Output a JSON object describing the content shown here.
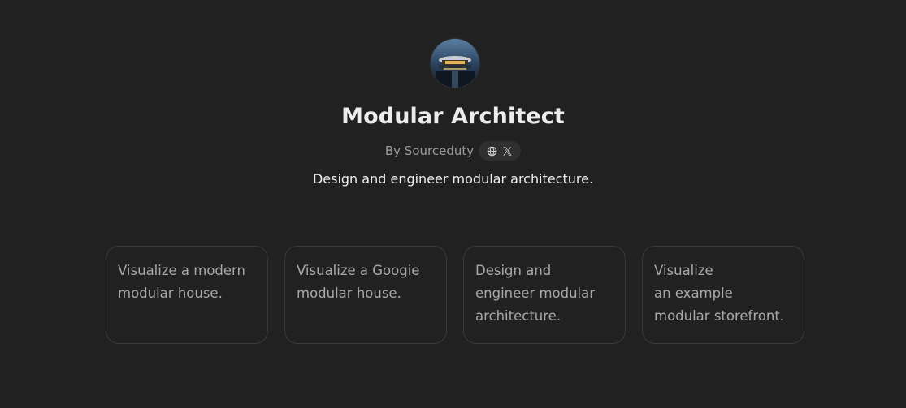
{
  "gpt": {
    "name": "Modular Architect",
    "byline": "By Sourceduty",
    "description": "Design and engineer modular architecture.",
    "social_icons": [
      "globe-icon",
      "x-logo-icon"
    ]
  },
  "conversation_starters": [
    "Visualize a modern\nmodular house.",
    "Visualize a Googie\nmodular house.",
    "Design and\nengineer modular\narchitecture.",
    "Visualize\nan example\nmodular storefront."
  ],
  "colors": {
    "background": "#212121",
    "pill": "#2f2f2f",
    "border": "#3a3a3a",
    "text_primary": "#ececec",
    "text_secondary": "#9b9b9b"
  }
}
